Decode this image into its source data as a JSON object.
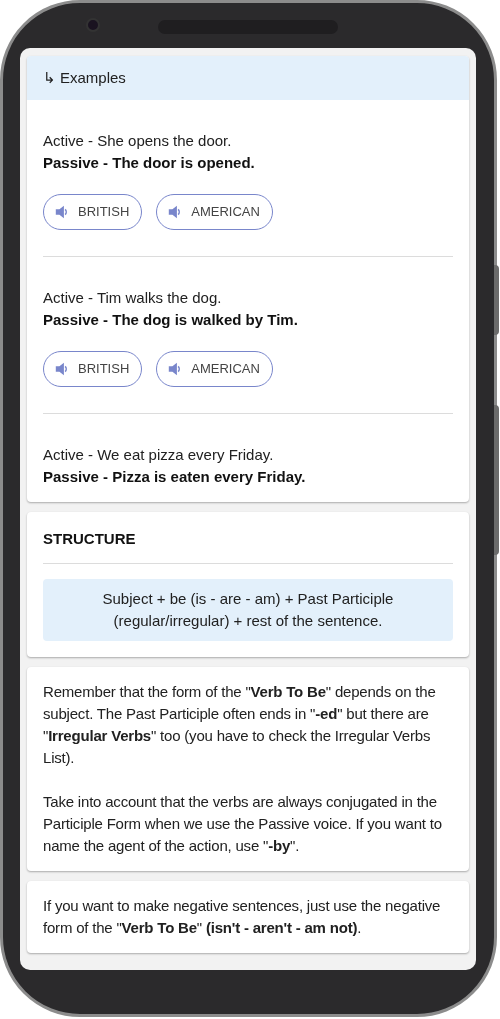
{
  "examples_card": {
    "header": {
      "icon": "↳",
      "title": "Examples"
    },
    "examples": [
      {
        "active": "Active - She opens the door.",
        "passive": "Passive - The door is opened.",
        "buttons": [
          "BRITISH",
          "AMERICAN"
        ]
      },
      {
        "active": "Active - Tim walks the dog.",
        "passive": "Passive - The dog is walked by Tim.",
        "buttons": [
          "BRITISH",
          "AMERICAN"
        ]
      },
      {
        "active": "Active - We eat pizza every Friday.",
        "passive": "Passive - Pizza is eaten every Friday."
      }
    ]
  },
  "structure_card": {
    "title": "STRUCTURE",
    "formula": "Subject + be (is - are - am) + Past Participle (regular/irregular) + rest of the sentence."
  },
  "note_cards": [
    {
      "paragraphs": [
        "Remember that the form of the \"**Verb To Be**\" depends on the subject. The Past Participle often ends in \"**-ed**\" but there are \"**Irregular Verbs**\" too (you have to check the Irregular Verbs List).",
        "Take into account that the verbs are always conjugated in the Participle Form when we use the Passive voice. If you want to name the agent of the action, use \"**-by**\"."
      ]
    },
    {
      "paragraphs": [
        "If you want to make negative sentences, just use the negative form of the \"**Verb To Be**\" **(isn't - aren't - am not)**."
      ]
    }
  ]
}
